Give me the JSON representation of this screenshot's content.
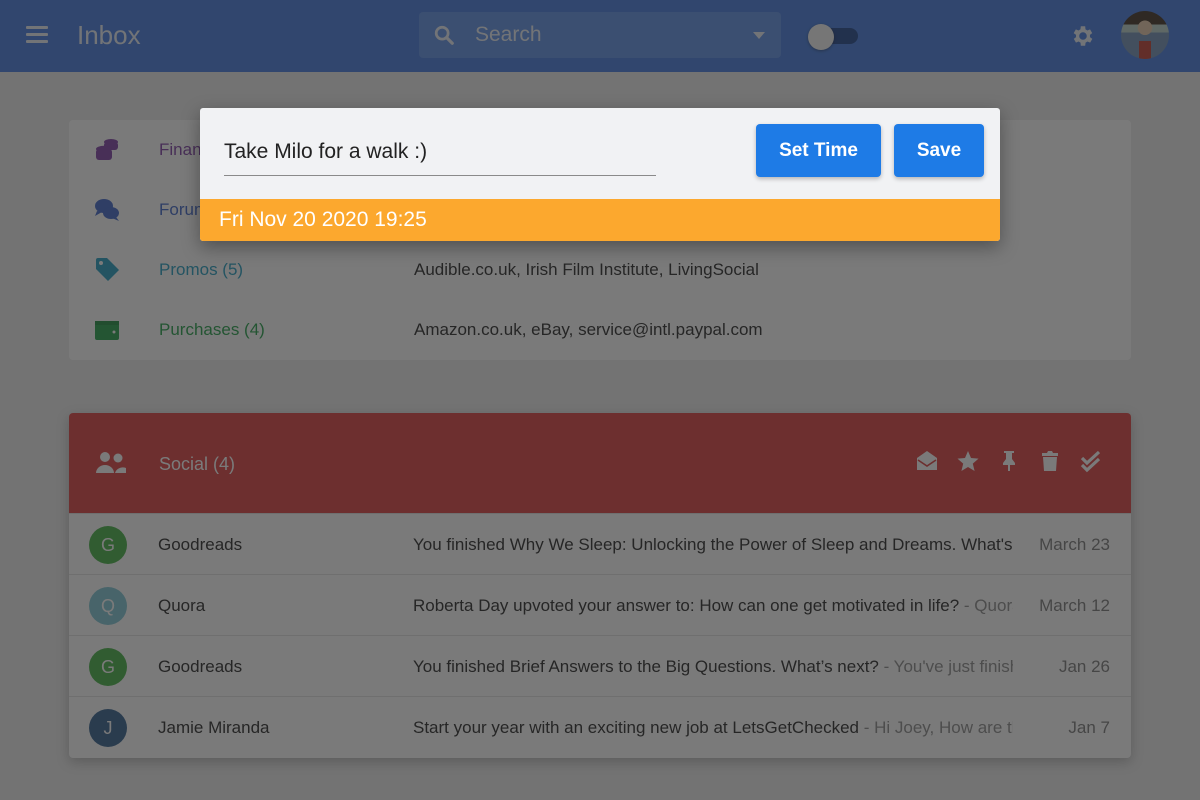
{
  "header": {
    "title": "Inbox",
    "search_placeholder": "Search",
    "toggle_on": false
  },
  "categories": [
    {
      "label": "Finance",
      "icon": "coins-icon",
      "color": "#7b3aa3",
      "senders": ""
    },
    {
      "label": "Forums",
      "icon": "chat-bubbles-icon",
      "color": "#3a63c9",
      "senders": ""
    },
    {
      "label": "Promos (5)",
      "icon": "tag-icon",
      "color": "#1d9bbf",
      "senders": "Audible.co.uk, Irish Film Institute, LivingSocial"
    },
    {
      "label": "Purchases (4)",
      "icon": "wallet-icon",
      "color": "#1f9d45",
      "senders": "Amazon.co.uk, eBay, service@intl.paypal.com"
    }
  ],
  "social": {
    "title": "Social (4)",
    "color": "#dc3a3a",
    "actions": [
      "mark-read",
      "star",
      "pin",
      "delete",
      "done-all"
    ],
    "emails": [
      {
        "initial": "G",
        "avatar_color": "#3fb13f",
        "from": "Goodreads",
        "subject": "You finished Why We Sleep: Unlocking the Power of Sleep and Dreams. What's next?",
        "snippet": "",
        "date": "March 23"
      },
      {
        "initial": "Q",
        "avatar_color": "#7cc6d4",
        "from": "Quora",
        "subject": "Roberta Day upvoted your answer to: How can one get motivated in life?",
        "snippet": " - Quora",
        "date": "March 12"
      },
      {
        "initial": "G",
        "avatar_color": "#3fb13f",
        "from": "Goodreads",
        "subject": "You finished Brief Answers to the Big Questions. What’s next?",
        "snippet": " - You've just finished",
        "date": "Jan 26"
      },
      {
        "initial": "J",
        "avatar_color": "#2f5d8c",
        "from": "Jamie Miranda",
        "subject": "Start your year with an exciting new job at LetsGetChecked",
        "snippet": " - Hi Joey, How are things",
        "date": "Jan 7"
      }
    ]
  },
  "reminder_dialog": {
    "text_value": "Take Milo for a walk :)",
    "set_time_label": "Set Time",
    "save_label": "Save",
    "datetime": "Fri Nov 20 2020 19:25",
    "date_bar_color": "#fca82e"
  }
}
